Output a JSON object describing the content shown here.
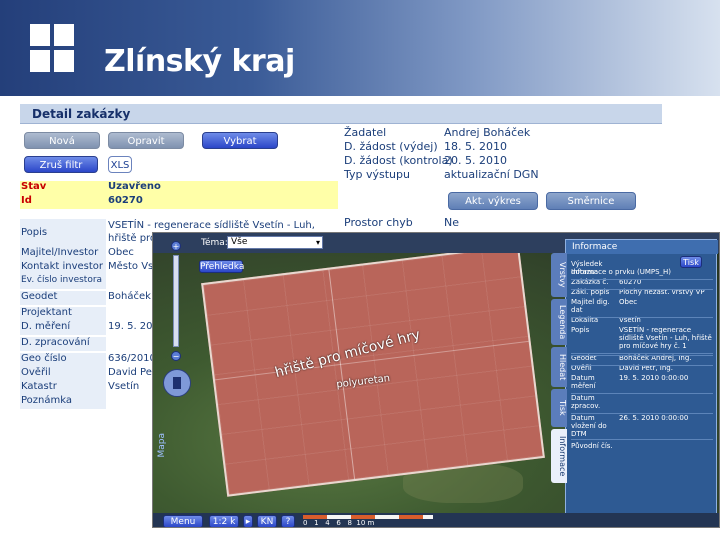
{
  "header": {
    "brand": "Zlínský kraj"
  },
  "detail": {
    "title": "Detail zakázky",
    "buttons": {
      "nova": "Nová",
      "opravit": "Opravit",
      "vybrat": "Vybrat",
      "zrus_filtr": "Zruš filtr",
      "xls": "XLS"
    },
    "rows": [
      {
        "label": "Stav",
        "value": "Uzavřeno"
      },
      {
        "label": "Id",
        "value": "60270"
      },
      {
        "label": "",
        "value": ""
      },
      {
        "label": "Popis",
        "value": "VSETÍN - regenerace sídliště Vsetín - Luh, hřiště pro míčové hry"
      },
      {
        "label": "Majitel/Investor",
        "value": "Obec"
      },
      {
        "label": "Kontakt investor",
        "value": "Město Vsetín"
      },
      {
        "label": "Ev. číslo investora",
        "value": ""
      },
      {
        "label": "Geodet",
        "value": "Boháček"
      },
      {
        "label": "Projektant",
        "value": ""
      },
      {
        "label": "D. měření",
        "value": "19. 5. 2010"
      },
      {
        "label": "D. zpracování",
        "value": ""
      },
      {
        "label": "Geo číslo",
        "value": "636/2010"
      },
      {
        "label": "Ověřil",
        "value": "David Petr"
      },
      {
        "label": "Katastr",
        "value": "Vsetín"
      },
      {
        "label": "Poznámka",
        "value": ""
      }
    ],
    "right": {
      "zadatel_label": "Žadatel",
      "zadatel": "Andrej Boháček",
      "d_zadost_vydej_label": "D. žádost (výdej)",
      "d_zadost_vydej": "18. 5. 2010",
      "d_zadost_kontrola_label": "D. žádost (kontrola)",
      "d_zadost_kontrola": "20. 5. 2010",
      "typ_vystupu_label": "Typ výstupu",
      "typ_vystupu": "aktualizační DGN",
      "prostor_chyb_label": "Prostor chyb",
      "prostor_chyb": "Ne",
      "btn_vykres": "Akt. výkres",
      "btn_smernice": "Směrnice"
    }
  },
  "map": {
    "tema_label": "Téma:",
    "tema_value": "Vše",
    "prehledka": "Přehledka",
    "labels": {
      "hriste": "hřiště pro míčové hry",
      "povrch": "polyuretan"
    },
    "bottom": {
      "menu": "Menu",
      "scale": "1:2 k",
      "kn": "KN",
      "help": "?",
      "scale_text": "0   1   4   6   8  10 m"
    },
    "vtabs": [
      "Vrstvy",
      "Legenda",
      "Hledat",
      "Tisk",
      "Informace"
    ],
    "info_panel": {
      "title": "Informace",
      "tisk": "Tisk",
      "rows": [
        {
          "a": "Výsledek dotazu:",
          "b": "Informace o prvku (UMPS_H)"
        },
        {
          "a": "Zakázka č.",
          "b": "60270"
        },
        {
          "a": "Zákl. popis",
          "b": "Plochy nezast. vrstvy VP"
        },
        {
          "a": "Majitel dig. dat",
          "b": "Obec"
        },
        {
          "a": "Lokalita",
          "b": "Vsetín"
        },
        {
          "a": "Popis",
          "b": "VSETÍN - regenerace sídliště Vsetín - Luh, hřiště pro míčové hry č. 1"
        },
        {
          "a": "Geodet",
          "b": "Boháček Andrej, Ing."
        },
        {
          "a": "Ověřil",
          "b": "David Petr, Ing."
        },
        {
          "a": "Datum měření",
          "b": "19. 5. 2010 0:00:00"
        },
        {
          "a": "Datum zpracov.",
          "b": ""
        },
        {
          "a": "Datum vložení do DTM",
          "b": "26. 5. 2010 0:00:00"
        },
        {
          "a": "Původní čís.",
          "b": ""
        }
      ]
    }
  }
}
